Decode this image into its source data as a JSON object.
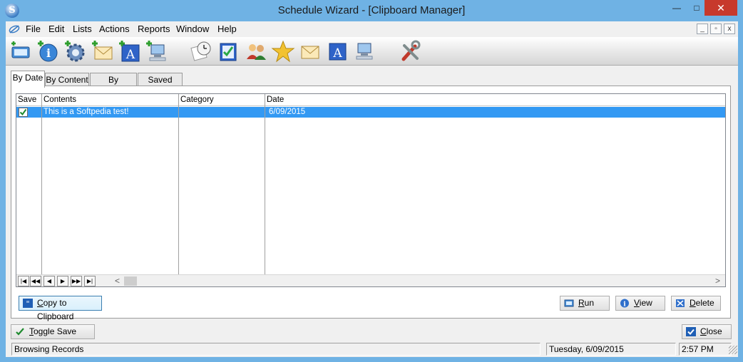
{
  "window": {
    "title": "Schedule Wizard - [Clipboard Manager]",
    "minimize_glyph": "—",
    "maximize_glyph": "□",
    "close_glyph": "✕",
    "app_icon_letter": "S",
    "mdi_minimize_glyph": "_",
    "mdi_restore_glyph": "▫",
    "mdi_close_glyph": "x"
  },
  "menu": {
    "items": [
      "File",
      "Edit",
      "Lists",
      "Actions",
      "Reports",
      "Window",
      "Help"
    ]
  },
  "toolbar": {
    "icons": [
      "new-schedule-icon",
      "info-add-icon",
      "settings-add-icon",
      "email-add-icon",
      "text-add-icon",
      "network-add-icon",
      "schedule-clock-icon",
      "task-check-icon",
      "contacts-icon",
      "favorites-star-icon",
      "email-icon",
      "text-icon",
      "network-icon",
      "tools-icon"
    ]
  },
  "tabs": [
    "By Date",
    "By Content",
    "By Category",
    "Saved Only"
  ],
  "active_tab": "By Date",
  "grid": {
    "columns": [
      "Save",
      "Contents",
      "Category",
      "Date"
    ],
    "rows": [
      {
        "save": true,
        "contents": "This is a Softpedia test!",
        "category": "",
        "date": "6/09/2015",
        "selected": true
      }
    ],
    "nav_buttons": [
      "|◀",
      "◀◀",
      "◀",
      "▶",
      "▶▶",
      "▶|"
    ],
    "scroll_left": "<",
    "scroll_right": ">"
  },
  "buttons": {
    "copy_to_clipboard_u": "C",
    "copy_to_clipboard_rest": "opy to Clipboard",
    "run_u": "R",
    "run_rest": "un",
    "view_u": "V",
    "view_rest": "iew",
    "delete_u": "D",
    "delete_rest": "elete",
    "toggle_save_u": "T",
    "toggle_save_rest": "oggle Save",
    "close_u": "C",
    "close_rest": "lose"
  },
  "status": {
    "message": "Browsing Records",
    "date": "Tuesday,  6/09/2015",
    "time": "2:57 PM"
  },
  "colors": {
    "title_bar": "#6fb2e4",
    "selection": "#3399f3",
    "close_button": "#c7392c"
  }
}
